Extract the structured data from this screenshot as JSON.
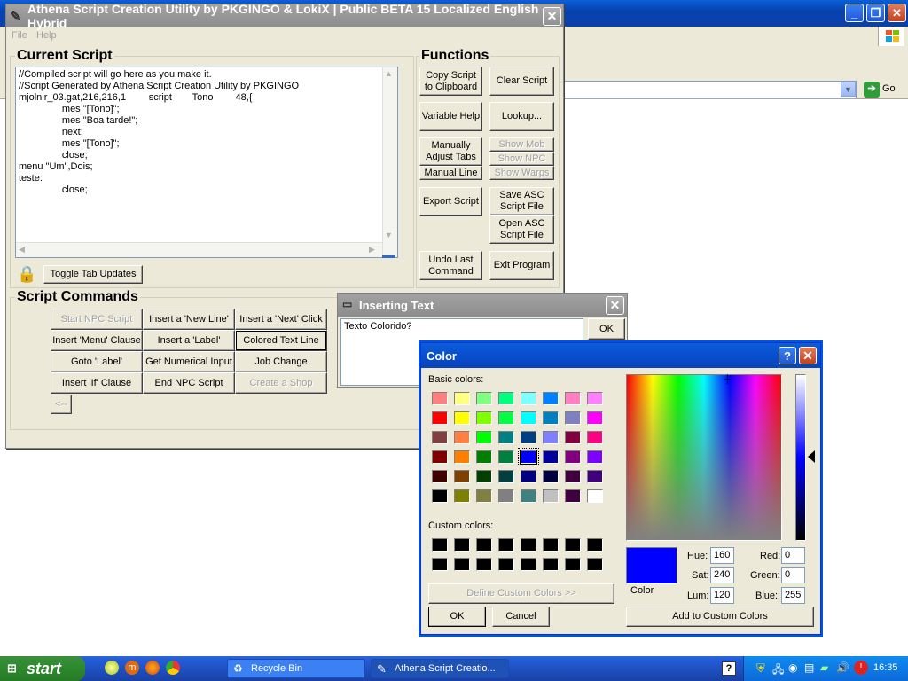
{
  "background_window": {
    "go_label": "Go"
  },
  "main_window": {
    "title": "Athena Script Creation Utility by PKGINGO & LokiX  |  Public BETA 15 Localized English Hybrid",
    "menu": [
      "File",
      "Help"
    ],
    "current_script_title": "Current Script",
    "script_text": "//Compiled script will go here as you make it.\n//Script Generated by Athena Script Creation Utility by PKGINGO\nmjolnir_03.gat,216,216,1\tscript\tTono\t48,{\n\t\tmes \"[Tono]\";\n\t\tmes \"Boa tarde!\";\n\t\tnext;\n\t\tmes \"[Tono]\";\n\t\tclose;\nmenu \"Um\",Dois;\nteste:\n\t\tclose;",
    "toggle_tab_updates": "Toggle Tab Updates",
    "functions_title": "Functions",
    "functions": {
      "copy_script": "Copy Script\nto Clipboard",
      "clear_script": "Clear Script",
      "variable_help": "Variable Help",
      "lookup": "Lookup...",
      "manually_adjust_tabs": "Manually\nAdjust Tabs",
      "manual_line": "Manual Line",
      "show_mob": "Show Mob",
      "show_npc": "Show NPC",
      "show_warps": "Show Warps",
      "export_script": "Export Script",
      "save_asc": "Save ASC\nScript File",
      "open_asc": "Open ASC\nScript File",
      "undo_last": "Undo Last\nCommand",
      "exit_program": "Exit Program"
    },
    "script_commands_title": "Script Commands",
    "commands": [
      [
        "Start NPC Script",
        "Insert a 'New Line'",
        "Insert a 'Next' Click"
      ],
      [
        "Insert 'Menu' Clause",
        "Insert a 'Label'",
        "Colored Text Line"
      ],
      [
        "Goto 'Label'",
        "Get Numerical Input",
        "Job Change"
      ],
      [
        "Insert 'If' Clause",
        "End NPC Script",
        "Create a Shop"
      ]
    ],
    "back_button": "<--"
  },
  "inserting_dialog": {
    "title": "Inserting Text",
    "value": "Texto Colorido?",
    "ok": "OK"
  },
  "color_dialog": {
    "title": "Color",
    "basic_colors_label": "Basic colors:",
    "basic_colors": [
      [
        "#ff8080",
        "#ffff80",
        "#80ff80",
        "#00ff80",
        "#80ffff",
        "#0080ff",
        "#ff80c0",
        "#ff80ff"
      ],
      [
        "#ff0000",
        "#ffff00",
        "#80ff00",
        "#00ff40",
        "#00ffff",
        "#0080c0",
        "#8080c0",
        "#ff00ff"
      ],
      [
        "#804040",
        "#ff8040",
        "#00ff00",
        "#008080",
        "#004080",
        "#8080ff",
        "#800040",
        "#ff0080"
      ],
      [
        "#800000",
        "#ff8000",
        "#008000",
        "#008040",
        "#0000ff",
        "#0000a0",
        "#800080",
        "#8000ff"
      ],
      [
        "#400000",
        "#804000",
        "#004000",
        "#004040",
        "#000080",
        "#000040",
        "#400040",
        "#400080"
      ],
      [
        "#000000",
        "#808000",
        "#808040",
        "#808080",
        "#408080",
        "#c0c0c0",
        "#400040",
        "#ffffff"
      ]
    ],
    "custom_colors_label": "Custom colors:",
    "custom_colors": [
      [
        "#000000",
        "#000000",
        "#000000",
        "#000000",
        "#000000",
        "#000000",
        "#000000",
        "#000000"
      ],
      [
        "#000000",
        "#000000",
        "#000000",
        "#000000",
        "#000000",
        "#000000",
        "#000000",
        "#000000"
      ]
    ],
    "define_custom": "Define Custom Colors >>",
    "ok": "OK",
    "cancel": "Cancel",
    "color_solid_label": "Color",
    "selected_color": "#0000ff",
    "hue_label": "Hue:",
    "hue": "160",
    "sat_label": "Sat:",
    "sat": "240",
    "lum_label": "Lum:",
    "lum": "120",
    "red_label": "Red:",
    "red": "0",
    "green_label": "Green:",
    "green": "0",
    "blue_label": "Blue:",
    "blue": "255",
    "add_custom": "Add to Custom Colors"
  },
  "taskbar": {
    "start": "start",
    "tasks": [
      "Recycle Bin",
      "Athena Script Creatio..."
    ],
    "clock": "16:35"
  }
}
